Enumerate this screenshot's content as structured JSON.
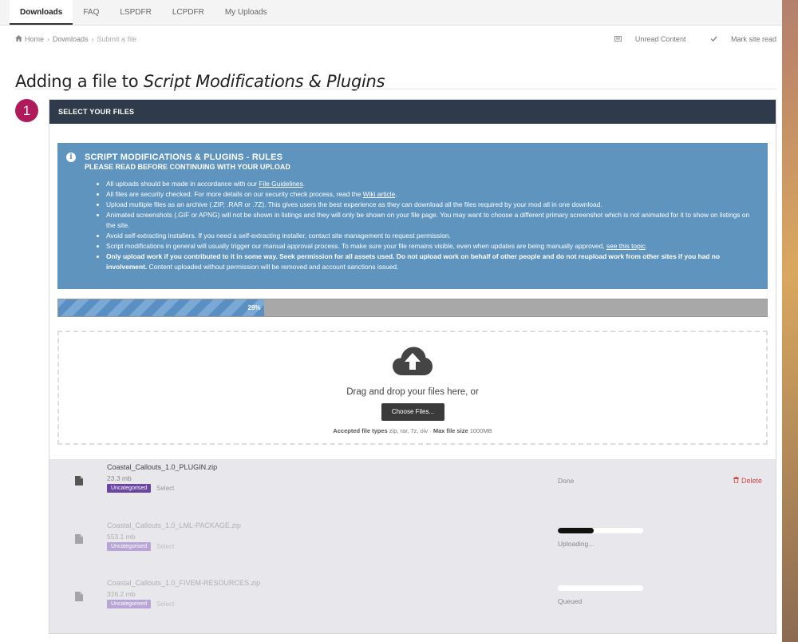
{
  "nav": {
    "tabs": [
      {
        "label": "Downloads",
        "active": true
      },
      {
        "label": "FAQ",
        "active": false
      },
      {
        "label": "LSPDFR",
        "active": false
      },
      {
        "label": "LCPDFR",
        "active": false
      },
      {
        "label": "My Uploads",
        "active": false
      }
    ]
  },
  "breadcrumb": {
    "home": "Home",
    "downloads": "Downloads",
    "current": "Submit a file",
    "unread": "Unread Content",
    "mark_read": "Mark site read"
  },
  "page": {
    "title_prefix": "Adding a file to",
    "title_category": "Script Modifications & Plugins",
    "step_number": "1",
    "step_title": "SELECT YOUR FILES"
  },
  "rules": {
    "heading": "SCRIPT MODIFICATIONS & PLUGINS - RULES",
    "subheading": "PLEASE READ BEFORE CONTINUING WITH YOUR UPLOAD",
    "items": {
      "r1_pre": "All uploads should be made in accordance with our ",
      "r1_link": "File Guidelines",
      "r1_post": ".",
      "r2_pre": "All files are security checked. For more details on our security check process, read the ",
      "r2_link": "Wiki article",
      "r2_post": ".",
      "r3": "Upload multiple files as an archive (.ZIP, .RAR or .7Z). This gives users the best experience as they can download all the files required by your mod all in one download.",
      "r4": "Animated screenshots (.GIF or APNG) will not be shown in listings and they will only be shown on your file page. You may want to choose a different primary screenshot which is not animated for it to show on listings on the site.",
      "r5": "Avoid self-extracting installers. If you need a self-extracting installer, contact site management to request permission.",
      "r6_pre": "Script modifications in general will usually trigger our manual approval process. To make sure your file remains visible, even when updates are being manually approved, ",
      "r6_link": "see this topic",
      "r6_post": ".",
      "r7_bold": "Only upload work if you contributed to it in some way. Seek permission for all assets used. Do not upload work on behalf of other people and do not reupload work from other sites if you had no involvement.",
      "r7_post": " Content uploaded without permission will be removed and account sanctions issued."
    }
  },
  "progress": {
    "percent": 29,
    "label": "29%"
  },
  "dropzone": {
    "text": "Drag and drop your files here, or",
    "button": "Choose Files...",
    "accepted_label": "Accepted file types",
    "accepted_types": "zip, rar, 7z, oiv",
    "sep": "·",
    "max_label": "Max file size",
    "max_size": "1000MB"
  },
  "files": [
    {
      "name": "Coastal_Callouts_1.0_PLUGIN.zip",
      "size": "23.3 mb",
      "tag": "Uncategorised",
      "select": "Select",
      "status": "Done",
      "delete": "Delete"
    },
    {
      "name": "Coastal_Callouts_1.0_LML-PACKAGE.zip",
      "size": "553.1 mb",
      "tag": "Uncategorised",
      "select": "Select",
      "status": "Uploading...",
      "progress": 0.42
    },
    {
      "name": "Coastal_Callouts_1.0_FIVEM-RESOURCES.zip",
      "size": "326.2 mb",
      "tag": "Uncategorised",
      "select": "Select",
      "status": "Queued",
      "progress": 0
    }
  ],
  "colors": {
    "step_badge": "#b01a5a",
    "panel_header": "#2f3b4a",
    "rules_bg": "#5f94bf",
    "tag": "#6b46a1",
    "delete": "#d04848"
  },
  "icons": [
    "home-icon",
    "unread-icon",
    "check-icon",
    "info-icon",
    "cloud-upload-icon",
    "file-icon",
    "trash-icon"
  ]
}
